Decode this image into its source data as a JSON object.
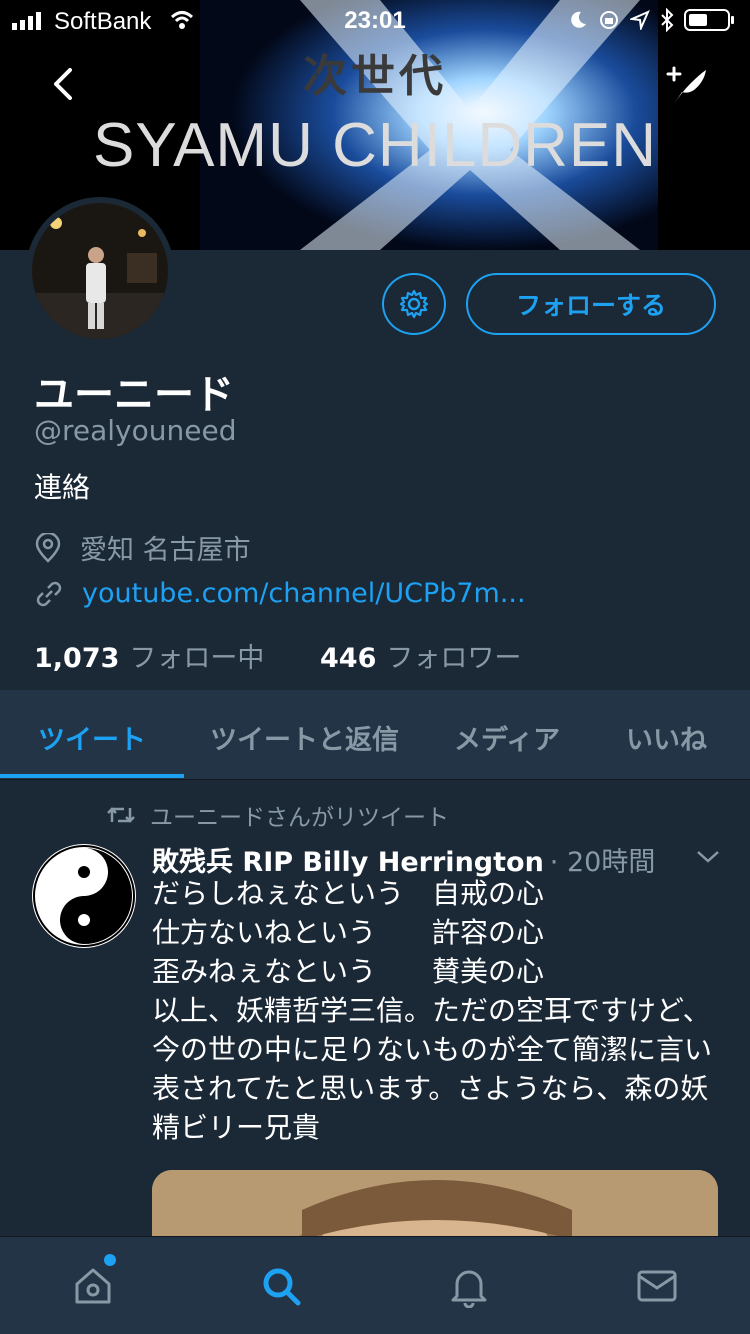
{
  "status_bar": {
    "carrier": "SoftBank",
    "time": "23:01"
  },
  "banner": {
    "kanji": "次世代",
    "title": "SYAMU CHILDREN"
  },
  "profile": {
    "name": "ユーニード",
    "handle": "@realyouneed",
    "bio": "連絡",
    "location": "愛知 名古屋市",
    "url": "youtube.com/channel/UCPb7m...",
    "following_count": "1,073",
    "following_label": "フォロー中",
    "followers_count": "446",
    "followers_label": "フォロワー",
    "follow_button": "フォローする"
  },
  "tabs": [
    {
      "label": "ツイート",
      "active": true
    },
    {
      "label": "ツイートと返信",
      "active": false
    },
    {
      "label": "メディア",
      "active": false
    },
    {
      "label": "いいね",
      "active": false
    }
  ],
  "tweet": {
    "retweet_label": "ユーニードさんがリツイート",
    "author": "敗残兵 RIP Billy Herrington",
    "time": "· 20時間",
    "text": "だらしねぇなという　自戒の心\n仕方ないねという　　許容の心\n歪みねぇなという　　賛美の心\n以上、妖精哲学三信。ただの空耳ですけど、今の世の中に足りないものが全て簡潔に言い表されてたと思います。さようなら、森の妖精ビリー兄貴"
  },
  "colors": {
    "accent": "#1da1f2",
    "background": "#1b2836",
    "secondary_text": "#8899a6"
  }
}
